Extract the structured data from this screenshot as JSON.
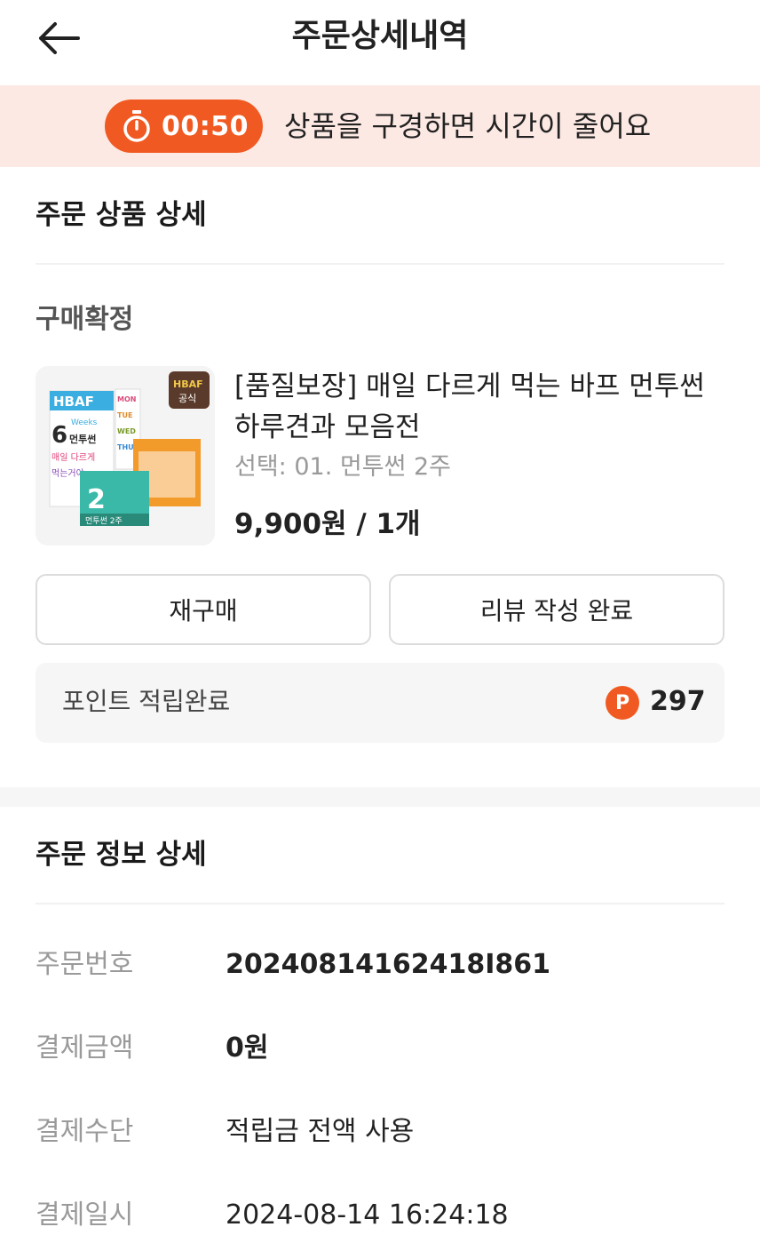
{
  "header": {
    "title": "주문상세내역",
    "back_icon": "arrow-left-icon"
  },
  "timer_banner": {
    "time": "00:50",
    "message": "상품을 구경하면 시간이 줄어요",
    "accent": "#f05a22",
    "background": "#fde9e4"
  },
  "product_section": {
    "title": "주문 상품 상세",
    "status": "구매확정",
    "product": {
      "thumbnail_text": {
        "brand": "HBAF",
        "badge": "공식",
        "weeks_number": "6",
        "weeks": "Weeks",
        "line1": "먼투썬",
        "line2": "매일 다르게",
        "line3": "먹는거야",
        "box_number": "2",
        "box_label": "먼투썬 2주",
        "days": [
          "MON",
          "TUE",
          "WED",
          "THU"
        ]
      },
      "name": "[품질보장] 매일 다르게 먹는 바프 먼투썬 하루견과 모음전",
      "option": "선택: 01. 먼투썬 2주",
      "price": "9,900원 / 1개"
    },
    "buttons": {
      "rebuy": "재구매",
      "review": "리뷰 작성 완료"
    },
    "points": {
      "label": "포인트 적립완료",
      "icon_letter": "P",
      "value": "297"
    }
  },
  "order_info": {
    "title": "주문 정보 상세",
    "rows": [
      {
        "label": "주문번호",
        "value": "20240814162418I861"
      },
      {
        "label": "결제금액",
        "value": "0원"
      },
      {
        "label": "결제수단",
        "value": "적립금 전액 사용"
      },
      {
        "label": "결제일시",
        "value": "2024-08-14 16:24:18"
      }
    ]
  }
}
